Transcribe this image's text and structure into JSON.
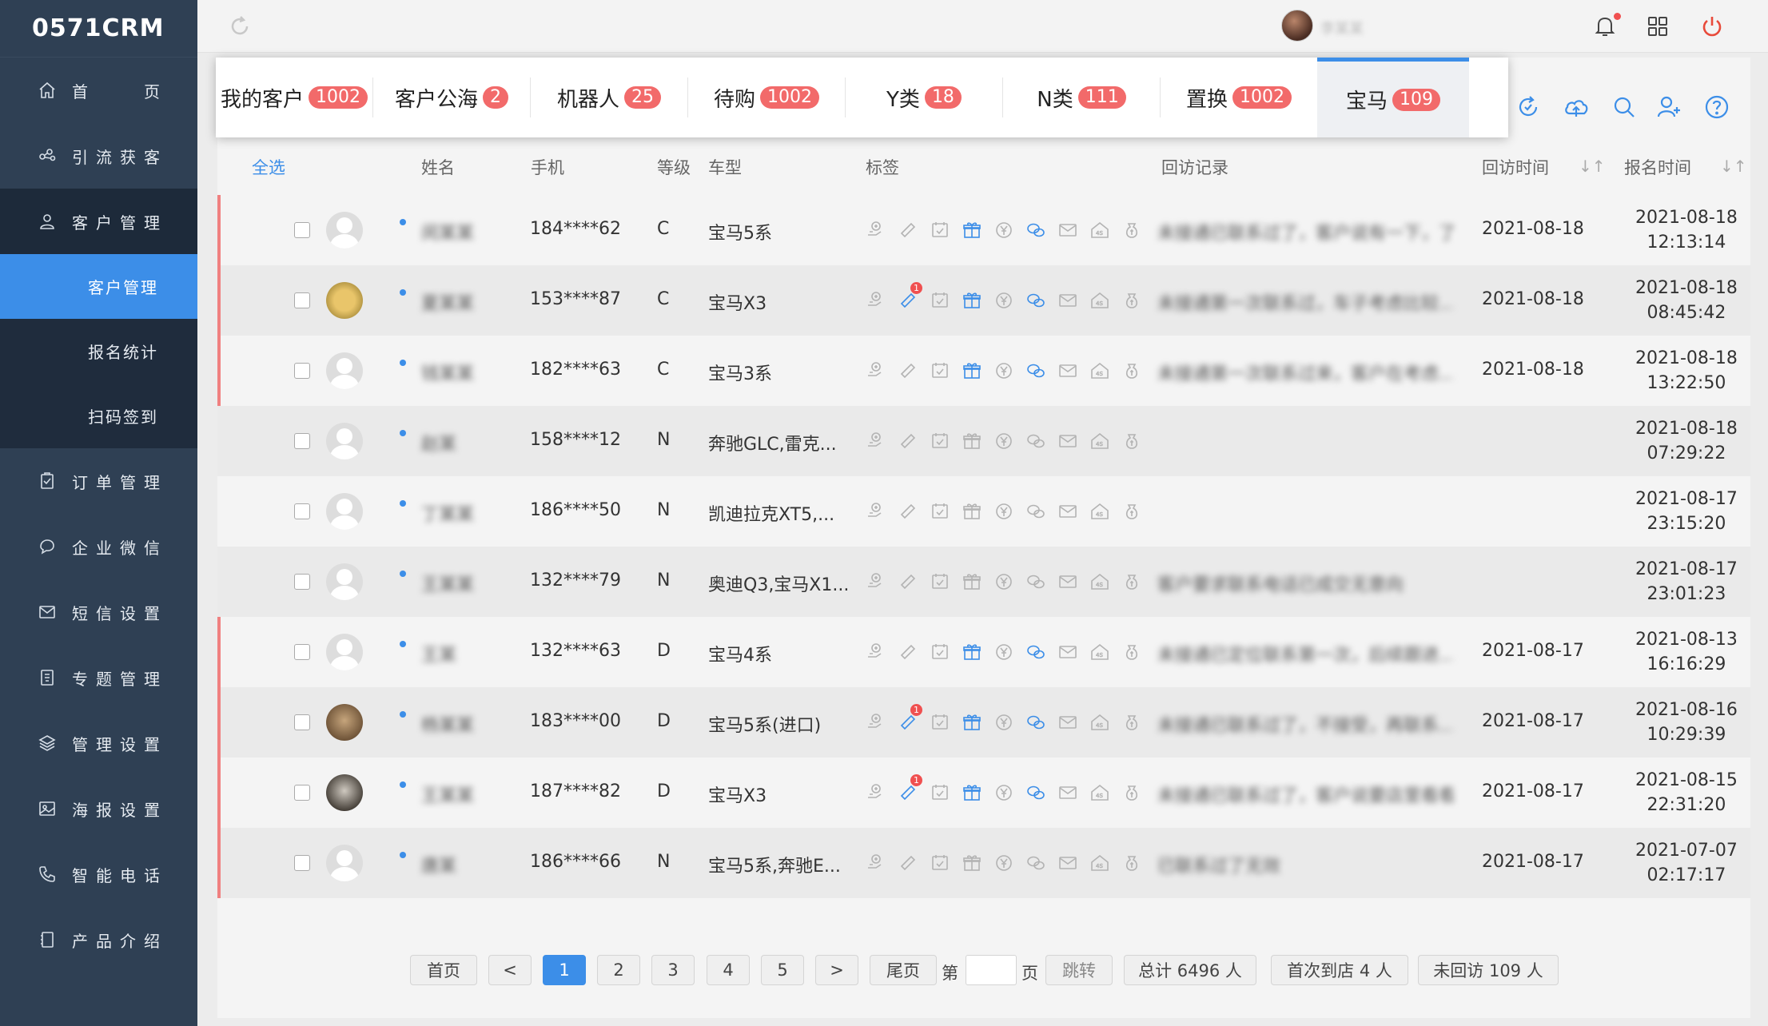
{
  "app": {
    "logo": "0571CRM"
  },
  "sidebar": {
    "items": [
      {
        "label": "首　　页",
        "icon": "home-icon"
      },
      {
        "label": "引流获客",
        "icon": "share-icon"
      },
      {
        "label": "客户管理",
        "icon": "user-icon"
      },
      {
        "label": "订单管理",
        "icon": "clipboard-icon"
      },
      {
        "label": "企业微信",
        "icon": "chat-icon"
      },
      {
        "label": "短信设置",
        "icon": "mail-icon"
      },
      {
        "label": "专题管理",
        "icon": "document-icon"
      },
      {
        "label": "管理设置",
        "icon": "layers-icon"
      },
      {
        "label": "海报设置",
        "icon": "image-icon"
      },
      {
        "label": "智能电话",
        "icon": "phone-icon"
      },
      {
        "label": "产品介绍",
        "icon": "book-icon"
      }
    ],
    "subitems": [
      {
        "label": "客户管理"
      },
      {
        "label": "报名统计"
      },
      {
        "label": "扫码签到"
      }
    ]
  },
  "topbar": {
    "user_name": "李某某"
  },
  "tabs": [
    {
      "label": "我的客户",
      "count": "1002"
    },
    {
      "label": "客户公海",
      "count": "2"
    },
    {
      "label": "机器人",
      "count": "25"
    },
    {
      "label": "待购",
      "count": "1002"
    },
    {
      "label": "Y类",
      "count": "18"
    },
    {
      "label": "N类",
      "count": "111"
    },
    {
      "label": "置换",
      "count": "1002"
    },
    {
      "label": "宝马",
      "count": "109"
    }
  ],
  "table": {
    "headers": {
      "select_all": "全选",
      "name": "姓名",
      "phone": "手机",
      "level": "等级",
      "car": "车型",
      "tags": "标签",
      "record": "回访记录",
      "visit_time": "回访时间",
      "signup_time": "报名时间"
    },
    "rows": [
      {
        "name": "闵某某",
        "phone": "184****62",
        "level": "C",
        "car": "宝马5系",
        "record": "未接通已联系过了，客户说有一下，了…",
        "visit": "2021-08-18",
        "date": "2021-08-18",
        "time": "12:13:14"
      },
      {
        "name": "夏某某",
        "phone": "153****87",
        "level": "C",
        "car": "宝马X3",
        "record": "未接通第一次联系过，车子考虑比较…",
        "visit": "2021-08-18",
        "date": "2021-08-18",
        "time": "08:45:42"
      },
      {
        "name": "钱某某",
        "phone": "182****63",
        "level": "C",
        "car": "宝马3系",
        "record": "未接通第一次联系过来，客户在考虑…",
        "visit": "2021-08-18",
        "date": "2021-08-18",
        "time": "13:22:50"
      },
      {
        "name": "赵某",
        "phone": "158****12",
        "level": "N",
        "car": "奔驰GLC,雷克...",
        "record": "",
        "visit": "",
        "date": "2021-08-18",
        "time": "07:29:22"
      },
      {
        "name": "丁某某",
        "phone": "186****50",
        "level": "N",
        "car": "凯迪拉克XT5,...",
        "record": "",
        "visit": "",
        "date": "2021-08-17",
        "time": "23:15:20"
      },
      {
        "name": "王某某",
        "phone": "132****79",
        "level": "N",
        "car": "奥迪Q3,宝马X1...",
        "record": "客户要求联系电话已成交无意向",
        "visit": "",
        "date": "2021-08-17",
        "time": "23:01:23"
      },
      {
        "name": "王某",
        "phone": "132****63",
        "level": "D",
        "car": "宝马4系",
        "record": "未接通已定位联系第一次，后续跟进…",
        "visit": "2021-08-17",
        "date": "2021-08-13",
        "time": "16:16:29"
      },
      {
        "name": "杨某某",
        "phone": "183****00",
        "level": "D",
        "car": "宝马5系(进口)",
        "record": "未接通已联系过了，不接受，再联系…",
        "visit": "2021-08-17",
        "date": "2021-08-16",
        "time": "10:29:39"
      },
      {
        "name": "王某某",
        "phone": "187****82",
        "level": "D",
        "car": "宝马X3",
        "record": "未接通已联系过了，客户说要店里看看…",
        "visit": "2021-08-17",
        "date": "2021-08-15",
        "time": "22:31:20"
      },
      {
        "name": "唐某",
        "phone": "186****66",
        "level": "N",
        "car": "宝马5系,奔驰E...",
        "record": "已联系过了无效",
        "visit": "2021-08-17",
        "date": "2021-07-07",
        "time": "02:17:17"
      }
    ]
  },
  "pagination": {
    "first": "首页",
    "prev": "<",
    "pages": [
      "1",
      "2",
      "3",
      "4",
      "5"
    ],
    "next": ">",
    "last": "尾页",
    "goto_prefix": "第",
    "goto_suffix": "页",
    "jump": "跳转",
    "total": "总计 6496 人",
    "first_visit": "首次到店 4 人",
    "not_visited": "未回访 109 人"
  },
  "colors": {
    "accent": "#3c8ee8",
    "badge": "#f26a6a",
    "sidebar": "#2f4054",
    "redbar": "#f08080"
  }
}
